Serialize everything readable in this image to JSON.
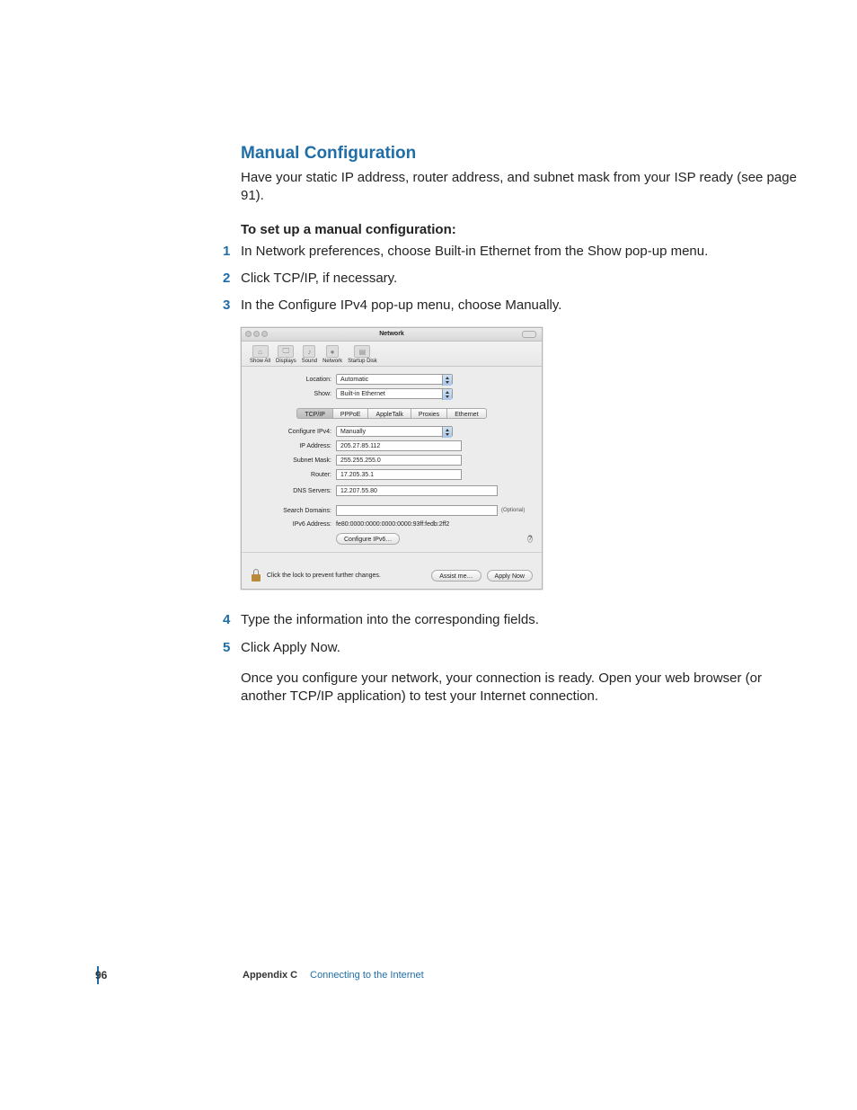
{
  "doc": {
    "heading": "Manual Configuration",
    "intro": "Have your static IP address, router address, and subnet mask from your ISP ready (see page 91).",
    "subhead": "To set up a manual configuration:",
    "steps_a": [
      "In Network preferences, choose Built-in Ethernet from the Show pop-up menu.",
      "Click TCP/IP, if necessary.",
      "In the Configure IPv4 pop-up menu, choose Manually."
    ],
    "steps_b": [
      "Type the information into the corresponding fields.",
      "Click Apply Now."
    ],
    "after": "Once you configure your network, your connection is ready. Open your web browser (or another TCP/IP application) to test your Internet connection."
  },
  "window": {
    "title": "Network",
    "toolbar": [
      {
        "label": "Show All"
      },
      {
        "label": "Displays"
      },
      {
        "label": "Sound"
      },
      {
        "label": "Network"
      },
      {
        "label": "Startup Disk"
      }
    ],
    "location_label": "Location:",
    "location_value": "Automatic",
    "show_label": "Show:",
    "show_value": "Built-in Ethernet",
    "tabs": [
      "TCP/IP",
      "PPPoE",
      "AppleTalk",
      "Proxies",
      "Ethernet"
    ],
    "active_tab": 0,
    "configure_label": "Configure IPv4:",
    "configure_value": "Manually",
    "fields": {
      "ip_label": "IP Address:",
      "ip_value": "205.27.85.112",
      "subnet_label": "Subnet Mask:",
      "subnet_value": "255.255.255.0",
      "router_label": "Router:",
      "router_value": "17.205.35.1",
      "dns_label": "DNS Servers:",
      "dns_value": "12.207.55.80",
      "search_label": "Search Domains:",
      "search_value": "",
      "optional": "(Optional)",
      "ipv6addr_label": "IPv6 Address:",
      "ipv6addr_value": "fe80:0000:0000:0000:0000:93ff:fedb:2ff2"
    },
    "config_ipv6_btn": "Configure IPv6…",
    "help_btn": "?",
    "lock_text": "Click the lock to prevent further changes.",
    "assist_btn": "Assist me…",
    "apply_btn": "Apply Now"
  },
  "footer": {
    "page": "96",
    "appendix": "Appendix C",
    "chapter": "Connecting to the Internet"
  }
}
